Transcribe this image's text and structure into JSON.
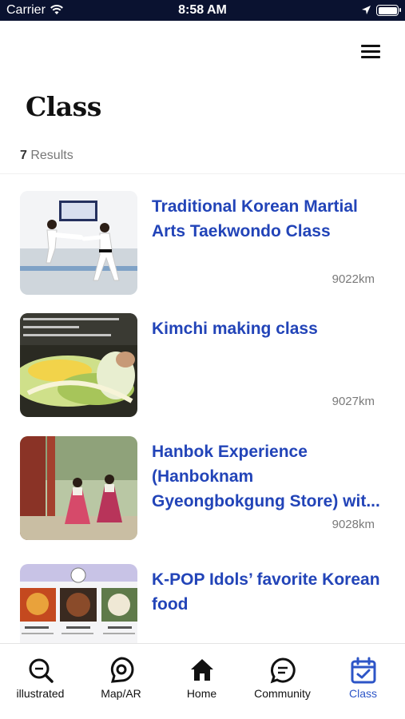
{
  "status_bar": {
    "carrier": "Carrier",
    "time": "8:58 AM",
    "icons": [
      "wifi-icon",
      "location-arrow-icon",
      "battery-icon"
    ]
  },
  "header": {
    "menu_icon": "hamburger-menu-icon",
    "title": "Class"
  },
  "results": {
    "count": "7",
    "label": " Results"
  },
  "classes": [
    {
      "title": "Traditional Korean Martial Arts Taekwondo Class",
      "distance": "9022km",
      "image": "taekwondo-photo"
    },
    {
      "title": "Kimchi making class",
      "distance": "9027km",
      "image": "kimchi-photo"
    },
    {
      "title": "Hanbok Experience (Hanboknam Gyeongbokgung Store) wit...",
      "distance": "9028km",
      "image": "hanbok-photo"
    },
    {
      "title": "K-POP Idols’ favorite Korean food",
      "distance": "",
      "image": "korean-food-photo"
    }
  ],
  "tabs": [
    {
      "label": "illustrated",
      "icon": "search-icon",
      "active": false
    },
    {
      "label": "Map/AR",
      "icon": "location-pin-icon",
      "active": false
    },
    {
      "label": "Home",
      "icon": "home-icon",
      "active": false
    },
    {
      "label": "Community",
      "icon": "chat-bubble-icon",
      "active": false
    },
    {
      "label": "Class",
      "icon": "calendar-check-icon",
      "active": true
    }
  ],
  "colors": {
    "status_bar": "#0a1230",
    "title_link": "#2244b8",
    "active_tab": "#2d55c7"
  }
}
